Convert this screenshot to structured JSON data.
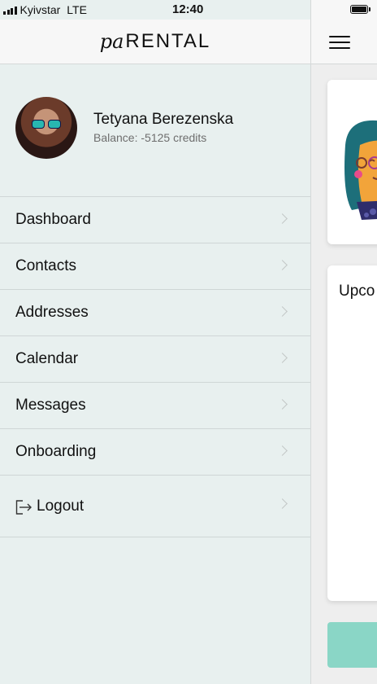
{
  "status_bar": {
    "carrier": "Kyivstar",
    "network": "LTE",
    "time": "12:40"
  },
  "app": {
    "logo_script": "pa",
    "logo_word": "RENTAL"
  },
  "profile": {
    "name": "Tetyana Berezenska",
    "balance": "Balance: -5125 credits"
  },
  "menu": [
    {
      "label": "Dashboard"
    },
    {
      "label": "Contacts"
    },
    {
      "label": "Addresses"
    },
    {
      "label": "Calendar"
    },
    {
      "label": "Messages"
    },
    {
      "label": "Onboarding"
    }
  ],
  "logout": {
    "label": "Logout"
  },
  "main": {
    "card_title_partial": "Upco"
  },
  "colors": {
    "accent": "#8ad6c6",
    "drawer_bg": "#e8f0ef",
    "header_bg": "#f7f7f7"
  },
  "icons": {
    "menu": "hamburger-icon",
    "chevron": "chevron-right-icon",
    "logout": "logout-icon",
    "battery": "battery-icon",
    "signal": "signal-icon"
  }
}
